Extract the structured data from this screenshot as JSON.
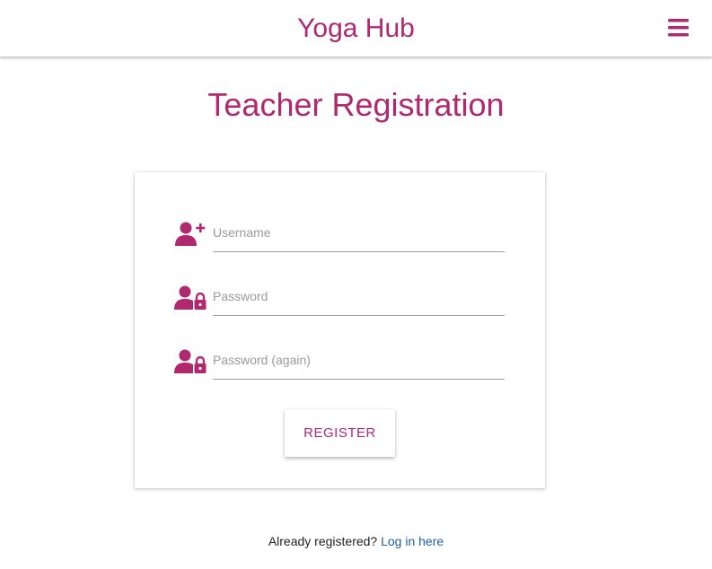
{
  "app": {
    "brand": "Yoga Hub",
    "accent_color": "#b0286e",
    "link_color": "#1e5fa8",
    "menu_icon": "hamburger-menu-icon"
  },
  "page": {
    "title": "Teacher Registration"
  },
  "form": {
    "fields": [
      {
        "icon": "user-plus-icon",
        "placeholder": "Username",
        "value": ""
      },
      {
        "icon": "user-lock-icon",
        "placeholder": "Password",
        "value": ""
      },
      {
        "icon": "user-lock-icon",
        "placeholder": "Password (again)",
        "value": ""
      }
    ],
    "submit_label": "REGISTER"
  },
  "footer": {
    "prompt": "Already registered?",
    "login_link": "Log in here"
  }
}
